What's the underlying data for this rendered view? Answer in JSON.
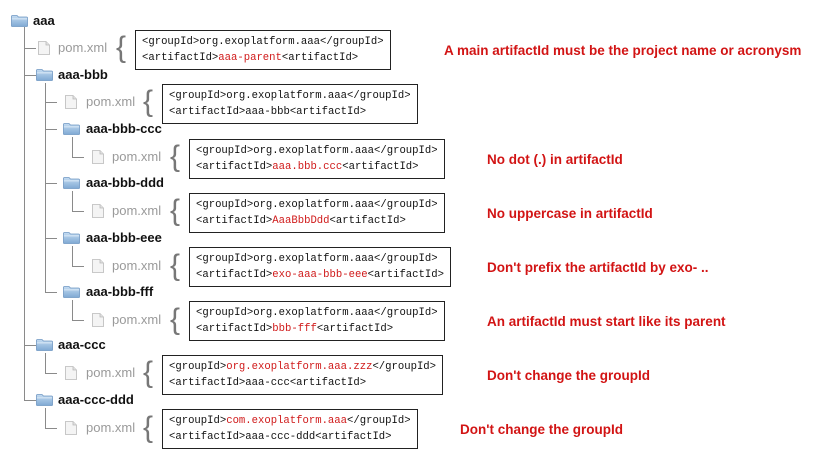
{
  "tree": {
    "root": "aaa",
    "root_pom": "pom.xml",
    "modules": [
      {
        "name": "aaa-bbb",
        "pom": "pom.xml"
      },
      {
        "name": "aaa-bbb-ccc",
        "pom": "pom.xml"
      },
      {
        "name": "aaa-bbb-ddd",
        "pom": "pom.xml"
      },
      {
        "name": "aaa-bbb-eee",
        "pom": "pom.xml"
      },
      {
        "name": "aaa-bbb-fff",
        "pom": "pom.xml"
      },
      {
        "name": "aaa-ccc",
        "pom": "pom.xml"
      },
      {
        "name": "aaa-ccc-ddd",
        "pom": "pom.xml"
      }
    ]
  },
  "snippets": [
    {
      "g_open": "<groupId>",
      "g_val": "org.exoplatform.aaa",
      "g_close": "</groupId>",
      "a_open": "<artifactId>",
      "a_val": "aaa-parent",
      "a_close": "<artifactId>",
      "g_hl": false,
      "a_hl": true
    },
    {
      "g_open": "<groupId>",
      "g_val": "org.exoplatform.aaa",
      "g_close": "</groupId>",
      "a_open": "<artifactId>",
      "a_val": "aaa-bbb",
      "a_close": "<artifactId>",
      "g_hl": false,
      "a_hl": false
    },
    {
      "g_open": "<groupId>",
      "g_val": "org.exoplatform.aaa",
      "g_close": "</groupId>",
      "a_open": "<artifactId>",
      "a_val": "aaa.bbb.ccc",
      "a_close": "<artifactId>",
      "g_hl": false,
      "a_hl": true
    },
    {
      "g_open": "<groupId>",
      "g_val": "org.exoplatform.aaa",
      "g_close": "</groupId>",
      "a_open": "<artifactId>",
      "a_val": "AaaBbbDdd",
      "a_close": "<artifactId>",
      "g_hl": false,
      "a_hl": true
    },
    {
      "g_open": "<groupId>",
      "g_val": "org.exoplatform.aaa",
      "g_close": "</groupId>",
      "a_open": "<artifactId>",
      "a_val": "exo-aaa-bbb-eee",
      "a_close": "<artifactId>",
      "g_hl": false,
      "a_hl": true
    },
    {
      "g_open": "<groupId>",
      "g_val": "org.exoplatform.aaa",
      "g_close": "</groupId>",
      "a_open": "<artifactId>",
      "a_val": "bbb-fff",
      "a_close": "<artifactId>",
      "g_hl": false,
      "a_hl": true
    },
    {
      "g_open": "<groupId>",
      "g_val": "org.exoplatform.aaa.zzz",
      "g_close": "</groupId>",
      "a_open": "<artifactId>",
      "a_val": "aaa-ccc",
      "a_close": "<artifactId>",
      "g_hl": true,
      "a_hl": false
    },
    {
      "g_open": "<groupId>",
      "g_val": "com.exoplatform.aaa",
      "g_close": "</groupId>",
      "a_open": "<artifactId>",
      "a_val": "aaa-ccc-ddd",
      "a_close": "<artifactId>",
      "g_hl": true,
      "a_hl": false
    }
  ],
  "notes": {
    "n0": "A main artifactId must be the project name or acronysm",
    "n2": "No dot (.) in artifactId",
    "n3": "No uppercase in artifactId",
    "n4": "Don't prefix the artifactId by exo- ..",
    "n5": "An artifactId must start like its parent",
    "n6": "Don't change the groupId",
    "n7": "Don't change the groupId"
  },
  "colors": {
    "highlight": "#d01a1a",
    "note_text": "#d21414",
    "folder": "#8fb8e0",
    "tree_line": "#8a8a8a"
  },
  "icons": [
    "folder-icon",
    "file-icon",
    "brace-icon"
  ]
}
